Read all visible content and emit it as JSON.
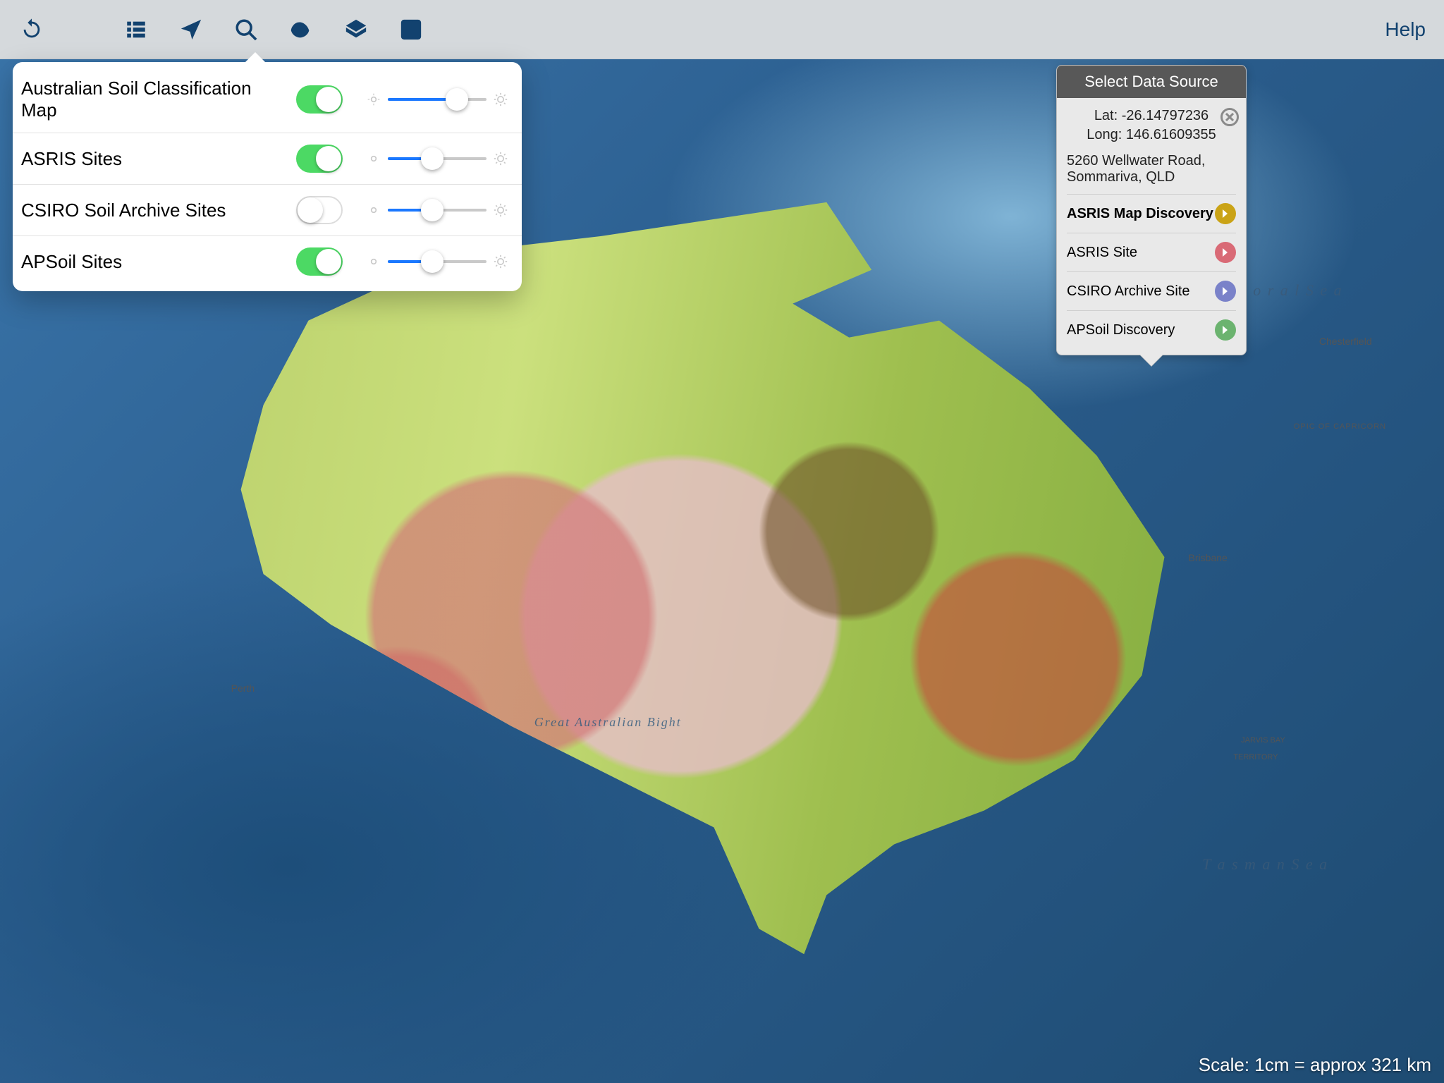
{
  "toolbar": {
    "help_label": "Help"
  },
  "layers_panel": {
    "items": [
      {
        "label": "Australian Soil Classification Map",
        "enabled": true,
        "opacity": 0.7
      },
      {
        "label": "ASRIS Sites",
        "enabled": true,
        "opacity": 0.45
      },
      {
        "label": "CSIRO Soil Archive Sites",
        "enabled": false,
        "opacity": 0.45
      },
      {
        "label": "APSoil Sites",
        "enabled": true,
        "opacity": 0.45
      }
    ]
  },
  "data_source_panel": {
    "title": "Select Data Source",
    "lat_label": "Lat:",
    "lat_value": "-26.14797236",
    "long_label": "Long:",
    "long_value": "146.61609355",
    "address_line1": "5260 Wellwater Road,",
    "address_line2": "Sommariva, QLD",
    "items": [
      {
        "label": "ASRIS Map Discovery",
        "color": "#caa316",
        "selected": true
      },
      {
        "label": "ASRIS Site",
        "color": "#d96a76",
        "selected": false
      },
      {
        "label": "CSIRO Archive Site",
        "color": "#7a82c9",
        "selected": false
      },
      {
        "label": "APSoil Discovery",
        "color": "#6bb36f",
        "selected": false
      }
    ]
  },
  "map_labels": {
    "bight": "Great Australian Bight",
    "tasman": "T a s m a n   S e a",
    "coral": "C o r a l   S e a",
    "perth": "Perth",
    "brisbane": "Brisbane",
    "chesterfield": "Chesterfield",
    "jarvis1": "JARVIS BAY",
    "jarvis2": "TERRITORY",
    "capricorn": "OPIC OF CAPRICORN"
  },
  "scale_text": "Scale: 1cm = approx 321 km"
}
